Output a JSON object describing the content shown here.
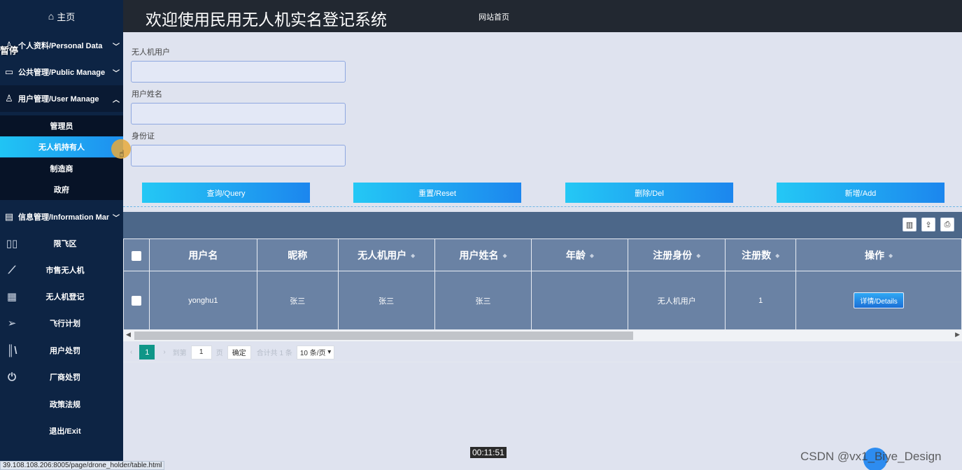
{
  "sidebar": {
    "home": "主页",
    "pause": "暂停",
    "menus": [
      {
        "label": "个人资料/Personal Data",
        "icon": "user-icon"
      },
      {
        "label": "公共管理/Public Manage",
        "icon": "monitor-icon"
      },
      {
        "label": "用户管理/User Manage",
        "icon": "user-icon"
      }
    ],
    "sub_items": [
      "管理员",
      "无人机持有人",
      "制造商",
      "政府"
    ],
    "info_menu": "信息管理/Information Manage",
    "nav": [
      {
        "label": "限飞区",
        "icon": "map-icon"
      },
      {
        "label": "市售无人机",
        "icon": "ruler-icon"
      },
      {
        "label": "无人机登记",
        "icon": "grid-icon"
      },
      {
        "label": "飞行计划",
        "icon": "send-icon"
      },
      {
        "label": "用户处罚",
        "icon": "library-icon"
      },
      {
        "label": "厂商处罚",
        "icon": "power-icon"
      },
      {
        "label": "政策法规",
        "icon": ""
      },
      {
        "label": "退出/Exit",
        "icon": ""
      }
    ]
  },
  "header": {
    "title": "欢迎使用民用无人机实名登记系统",
    "home_link": "网站首页"
  },
  "search": {
    "fields": [
      {
        "label": "无人机用户",
        "value": ""
      },
      {
        "label": "用户姓名",
        "value": ""
      },
      {
        "label": "身份证",
        "value": ""
      }
    ],
    "buttons": [
      "查询/Query",
      "重置/Reset",
      "删除/Del",
      "新增/Add"
    ]
  },
  "table": {
    "columns": [
      "用户名",
      "昵称",
      "无人机用户",
      "用户姓名",
      "年龄",
      "注册身份",
      "注册数",
      "操作"
    ],
    "rows": [
      {
        "username": "yonghu1",
        "nickname": "张三",
        "drone_user": "张三",
        "real_name": "张三",
        "age": "",
        "role": "无人机用户",
        "count": "1",
        "action": "详情/Details"
      }
    ]
  },
  "pager": {
    "current": "1",
    "goto_label": "到第",
    "page_input": "1",
    "page_unit": "页",
    "confirm": "确定",
    "total": "合计共 1 条",
    "page_size": "10 条/页"
  },
  "overlay": {
    "status_url": "39.108.108.206:8005/page/drone_holder/table.html",
    "timer": "00:11:51",
    "watermark": "CSDN @vx1_Biye_Design"
  },
  "colors": {
    "sidebar_bg": "#0d2444",
    "topbar_bg": "#222831",
    "accent": "#1c86ee",
    "table_bg": "#6a82a4",
    "pager_active": "#0f9688"
  }
}
